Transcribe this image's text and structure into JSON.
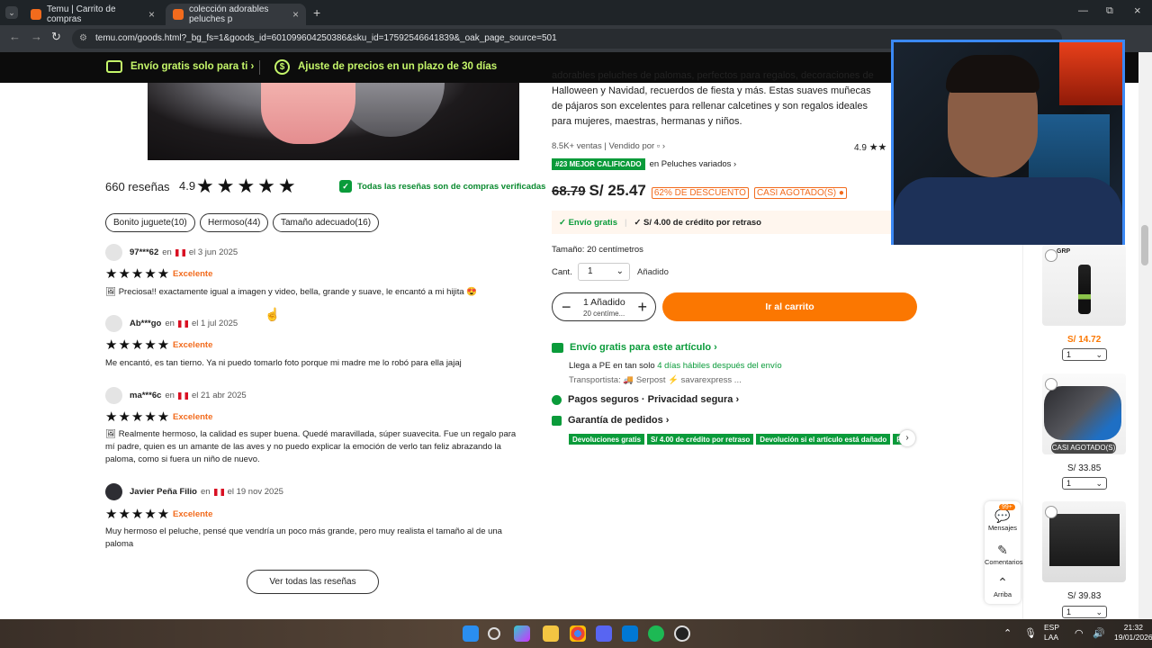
{
  "browser": {
    "tabs": [
      {
        "title": "Temu | Carrito de compras"
      },
      {
        "title": "colección adorables peluches p"
      }
    ],
    "url": "temu.com/goods.html?_bg_fs=1&goods_id=601099604250386&sku_id=17592546641839&_oak_page_source=501"
  },
  "banner": {
    "free_shipping": "Envío gratis solo para ti ›",
    "price_adjust": "Ajuste de precios en un plazo de 30 días"
  },
  "reviews": {
    "count": "660 reseñas",
    "score": "4.9",
    "verified": "Todas las reseñas son de compras verificadas",
    "tags": [
      "Bonito juguete(10)",
      "Hermoso(44)",
      "Tamaño adecuado(16)"
    ],
    "items": [
      {
        "user": "97***62",
        "prefix": "en",
        "date": "el 3 jun 2025",
        "rating": "Excelente",
        "text": "🖼  Preciosa!! exactamente igual a imagen y video, bella, grande y suave, le encantó a mi hijita 😍"
      },
      {
        "user": "Ab***go",
        "prefix": "en",
        "date": "el 1 jul 2025",
        "rating": "Excelente",
        "text": "Me encantó, es tan tierno. Ya ni puedo tomarlo foto porque mi madre me lo robó para ella jajaj"
      },
      {
        "user": "ma***6c",
        "prefix": "en",
        "date": "el 21 abr 2025",
        "rating": "Excelente",
        "text": "🖼  Realmente hermoso, la calidad es super buena. Quedé maravillada, súper suavecita. Fue un regalo para mí padre, quien es un amante de las aves y no puedo explicar la emoción de verlo tan feliz abrazando la paloma, como si fuera un niño de nuevo."
      },
      {
        "user": "Javier Peña Filio",
        "prefix": "en",
        "date": "el 19 nov 2025",
        "rating": "Excelente",
        "text": "Muy hermoso el peluche, pensé que vendría un poco más grande, pero muy realista el tamaño al de una paloma"
      }
    ],
    "see_all": "Ver todas las reseñas"
  },
  "product": {
    "description": "adorables peluches de palomas, perfectos para regalos, decoraciones de Halloween y Navidad, recuerdos de fiesta y más. Estas suaves muñecas de pájaros son excelentes para rellenar calcetines y son regalos ideales para mujeres, maestras, hermanas y niños.",
    "sales": "8.5K+ ventas | Vendido por ▫ ›",
    "rating": "4.9",
    "rank_badge": "#23 MEJOR CALIFICADO",
    "rank_category": "en Peluches variados ›",
    "old_price": "68.79",
    "price": "S/ 25.47",
    "discount": "62% DE DESCUENTO",
    "stock": "CASI AGOTADO(S) ●",
    "ship_free": "✓ Envío gratis",
    "ship_credit": "✓ S/ 4.00 de crédito por retraso",
    "size": "Tamaño: 20 centímetros",
    "qty_label": "Cant.",
    "qty_value": "1",
    "added": "Añadido",
    "stepper_minus": "−",
    "stepper_plus": "+",
    "stepper_main": "1 Añadido",
    "stepper_sub": "20 centíme...",
    "cart_button": "Ir al carrito",
    "free_ship_title": "Envío gratis para este artículo ›",
    "arrive_prefix": "Llega a PE en tan solo",
    "arrive_days": "4 días hábiles después del envío",
    "carriers": "Transportista:  🚚 Serpost  ⚡ savarexpress ...",
    "secure_pay": "Pagos seguros · Privacidad segura ›",
    "guarantee": "Garantía de pedidos ›",
    "guarantee_chips": [
      "Devoluciones gratis",
      "S/ 4.00 de crédito por retraso",
      "Devolución si el artículo está dañado",
      "Reembolso"
    ]
  },
  "sidebar": {
    "items": [
      {
        "label": "GRP",
        "price": "S/ 14.72",
        "qty": "1"
      },
      {
        "label": "CASI AGOTADO(S)",
        "price": "S/ 33.85",
        "qty": "1"
      },
      {
        "label": "",
        "price": "S/ 39.83",
        "qty": "1"
      }
    ],
    "messages": "Mensajes",
    "messages_badge": "99+",
    "comments": "Comentarios",
    "top": "Arriba"
  },
  "taskbar": {
    "lang1": "ESP",
    "lang2": "LAA",
    "time": "21:32",
    "date": "19/01/2026"
  },
  "colors": {
    "accent": "#fb7701",
    "green": "#0a9b3a",
    "banner_green": "#c5f66a"
  }
}
